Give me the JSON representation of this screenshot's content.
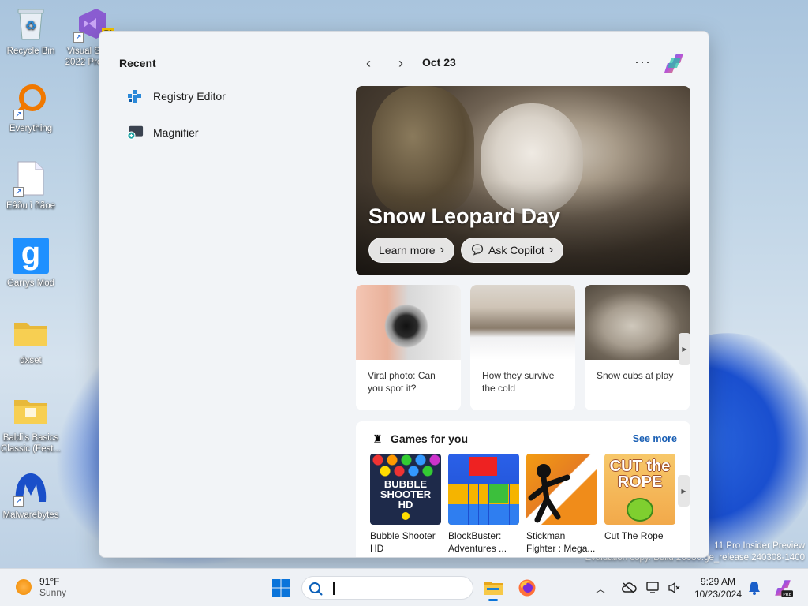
{
  "desktop": {
    "icons": [
      {
        "label": "Recycle Bin"
      },
      {
        "label": "Visual S 2022 Pre"
      },
      {
        "label": "Everything"
      },
      {
        "label": "Eâõu ì ñãoe"
      },
      {
        "label": "Garrys Mod"
      },
      {
        "label": "dxset"
      },
      {
        "label": "Baldi's Basics Classic (Fest..."
      },
      {
        "label": "Malwarebytes"
      }
    ],
    "vs_badge": "PI",
    "watermark_line1": "11 Pro Insider Preview",
    "watermark_line2": "Evaluation copy. Build 26080.ge_release.240308-1400"
  },
  "start_menu": {
    "recent_title": "Recent",
    "recent_items": [
      {
        "label": "Registry Editor",
        "icon": "registry-editor-icon"
      },
      {
        "label": "Magnifier",
        "icon": "magnifier-icon"
      }
    ],
    "date": "Oct 23",
    "hero": {
      "title": "Snow Leopard Day",
      "learn_more": "Learn more",
      "ask_copilot": "Ask Copilot"
    },
    "cards": [
      {
        "text": "Viral photo: Can you spot it?"
      },
      {
        "text": "How they survive the cold"
      },
      {
        "text": "Snow cubs at play"
      }
    ],
    "games": {
      "title": "Games for you",
      "see_more": "See more",
      "items": [
        {
          "name": "Bubble Shooter HD",
          "thumb_text": "BUBBLE SHOOTER HD"
        },
        {
          "name": "BlockBuster: Adventures ..."
        },
        {
          "name": "Stickman Fighter : Mega..."
        },
        {
          "name": "Cut The Rope",
          "thumb_text": "CUT the ROPE"
        }
      ]
    }
  },
  "taskbar": {
    "weather_temp": "91°F",
    "weather_cond": "Sunny",
    "search_placeholder": "",
    "time": "9:29 AM",
    "date": "10/23/2024"
  },
  "colors": {
    "accent": "#1a5fb4",
    "windows_blue": "#0a74da"
  }
}
